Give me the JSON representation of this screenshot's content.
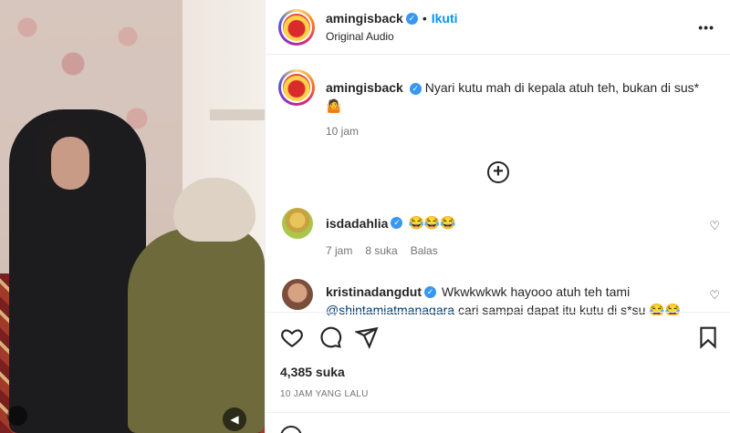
{
  "header": {
    "username": "amingisback",
    "dot": "•",
    "follow_label": "Ikuti",
    "audio": "Original Audio",
    "more_icon": "more-horizontal-icon"
  },
  "caption": {
    "username": "amingisback",
    "text": "Nyari kutu mah di kepala atuh teh, bukan di sus*",
    "emoji": "🤷",
    "time": "10 jam"
  },
  "comments": [
    {
      "username": "isdadahlia",
      "text": "😂😂😂",
      "time": "7 jam",
      "likes": "8 suka",
      "reply": "Balas"
    },
    {
      "username": "kristinadangdut",
      "text": "Wkwkwkwk hayooo atuh teh tami",
      "mention": "@shintamiatmanagara",
      "text2": " cari sampai dapat itu kutu di s*su 😂😂"
    }
  ],
  "post": {
    "likes": "4,385 suka",
    "timestamp": "10 JAM YANG LALU"
  },
  "colors": {
    "accent": "#0095f6",
    "verified": "#3897f0",
    "muted": "#737373"
  }
}
